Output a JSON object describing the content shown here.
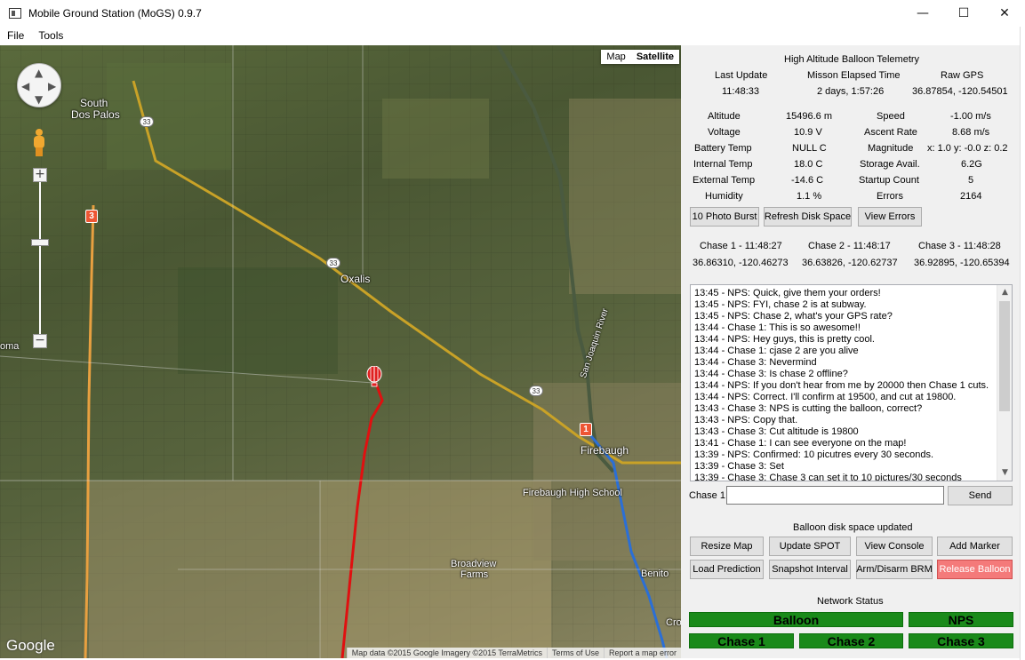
{
  "window": {
    "title": "Mobile Ground Station (MoGS) 0.9.7",
    "minimize": "—",
    "maximize": "☐",
    "close": "✕"
  },
  "menu": [
    "File",
    "Tools"
  ],
  "map": {
    "type_buttons": {
      "map": "Map",
      "satellite": "Satellite"
    },
    "zoom_in": "+",
    "zoom_out": "−",
    "labels": {
      "south_dos_palos_1": "South",
      "south_dos_palos_2": "Dos Palos",
      "oxalis": "Oxalis",
      "firebaugh": "Firebaugh",
      "firebaugh_high": "Firebaugh High School",
      "broadview_1": "Broadview",
      "broadview_2": "Farms",
      "benito": "Benito",
      "ma": "oma",
      "cro": "Cro",
      "river": "San Joaquin River"
    },
    "route_shields": [
      "33",
      "33",
      "33"
    ],
    "route_boxes": [
      "3",
      "1"
    ],
    "google_logo": "Google",
    "footer": [
      "Map data ©2015 Google Imagery ©2015 TerraMetrics",
      "Terms of Use",
      "Report a map error"
    ]
  },
  "telemetry": {
    "heading": "High Altitude Balloon Telemetry",
    "header_labels": {
      "last_update": "Last Update",
      "elapsed": "Misson Elapsed Time",
      "raw_gps": "Raw GPS"
    },
    "header_values": {
      "last_update": "11:48:33",
      "elapsed": "2 days, 1:57:26",
      "raw_gps": "36.87854, -120.54501"
    },
    "left": [
      {
        "label": "Altitude",
        "value": "15496.6 m"
      },
      {
        "label": "Voltage",
        "value": "10.9 V"
      },
      {
        "label": "Battery Temp",
        "value": "NULL C"
      },
      {
        "label": "Internal Temp",
        "value": "18.0 C"
      },
      {
        "label": "External Temp",
        "value": "-14.6 C"
      },
      {
        "label": "Humidity",
        "value": "1.1 %"
      }
    ],
    "right": [
      {
        "label": "Speed",
        "value": "-1.00 m/s"
      },
      {
        "label": "Ascent Rate",
        "value": "8.68 m/s"
      },
      {
        "label": "Magnitude",
        "value": "x: 1.0 y: -0.0 z: 0.2"
      },
      {
        "label": "Storage Avail.",
        "value": "6.2G"
      },
      {
        "label": "Startup Count",
        "value": "5"
      },
      {
        "label": "Errors",
        "value": "2164"
      }
    ],
    "buttons": {
      "photo_burst": "10 Photo Burst",
      "refresh_disk": "Refresh Disk Space",
      "view_errors": "View Errors"
    }
  },
  "chase": [
    {
      "label": "Chase 1 - 11:48:27",
      "coords": "36.86310, -120.46273"
    },
    {
      "label": "Chase 2 - 11:48:17",
      "coords": "36.63826, -120.62737"
    },
    {
      "label": "Chase 3 - 11:48:28",
      "coords": "36.92895, -120.65394"
    }
  ],
  "log": [
    "13:45 - NPS: Quick, give them your orders!",
    "13:45 - NPS: FYI, chase 2 is at subway.",
    "13:45 - NPS: Chase 2, what's your GPS rate?",
    "13:44 - Chase 1: This is so awesome!!",
    "13:44 - NPS: Hey guys, this is pretty cool.",
    "13:44 - Chase 1: cjase 2 are you alive",
    "13:44 - Chase 3: Nevermind",
    "13:44 - Chase 3: Is chase 2 offline?",
    "13:44 - NPS: If you don't hear from me by 20000 then Chase 1 cuts.",
    "13:44 - NPS: Correct. I'll confirm at 19500, and cut at 19800.",
    "13:43 - Chase 3: NPS is cutting the balloon, correct?",
    "13:43 - NPS: Copy that.",
    "13:43 - Chase 3: Cut altitude is 19800",
    "13:41 - Chase 1: I can see everyone on the map!",
    "13:39 - NPS: Confirmed: 10 picutres every 30 seconds.",
    "13:39 - Chase 3: Set",
    "13:39 - Chase 3: Chase 3 can set it to 10 pictures/30 seconds"
  ],
  "chat": {
    "sender_label": "Chase 1",
    "input_value": "",
    "send": "Send"
  },
  "status_message": "Balloon disk space updated",
  "actions": {
    "resize_map": "Resize Map",
    "update_spot": "Update SPOT",
    "view_console": "View Console",
    "add_marker": "Add Marker",
    "load_prediction": "Load Prediction",
    "snapshot_interval": "Snapshot Interval",
    "arm_brm": "Arm/Disarm BRM",
    "release_balloon": "Release Balloon"
  },
  "network": {
    "heading": "Network Status",
    "balloon": "Balloon",
    "nps": "NPS",
    "chase1": "Chase 1",
    "chase2": "Chase 2",
    "chase3": "Chase 3",
    "color_ok": "#1a8a1a"
  }
}
